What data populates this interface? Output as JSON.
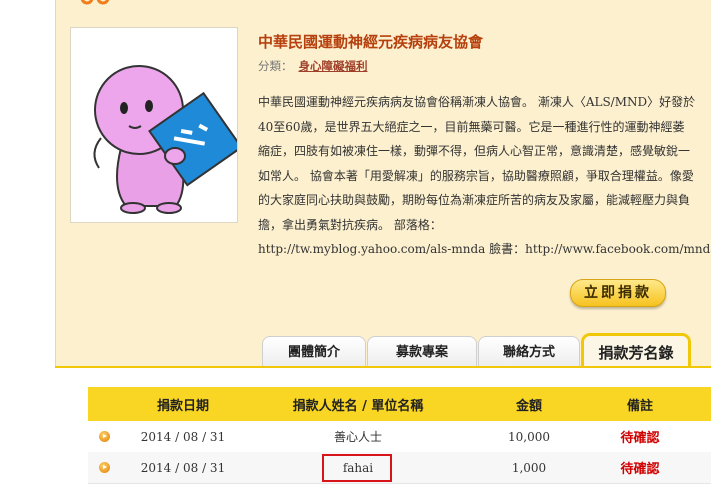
{
  "organization": {
    "name": "中華民國運動神經元疾病病友協會",
    "category_label": "分類：",
    "category_value": "身心障礙福利",
    "description": "中華民國運動神經元疾病病友協會俗稱漸凍人協會。 漸凍人〈ALS/MND〉好發於40至60歲，是世界五大絕症之一，目前無藥可醫。它是一種進行性的運動神經萎縮症，四肢有如被凍住一樣，動彈不得，但病人心智正常，意識清楚，感覺敏銳一如常人。 協會本著「用愛解凍」的服務宗旨，協助醫療照顧，爭取合理權益。像愛的大家庭同心扶助與鼓勵，期盼每位為漸凍症所苦的病友及家屬，能減輕壓力與負擔，拿出勇氣對抗疾病。 部落格：",
    "description_urls": "http://tw.myblog.yahoo.com/als-mnda 臉書：http://www.facebook.com/mnda.tw"
  },
  "donate_button_label": "立即捐款",
  "tabs": [
    {
      "label": "團體簡介"
    },
    {
      "label": "募款專案"
    },
    {
      "label": "聯絡方式"
    },
    {
      "label": "捐款芳名錄"
    }
  ],
  "table": {
    "headers": [
      "捐款日期",
      "捐款人姓名 / 單位名稱",
      "金額",
      "備註"
    ],
    "rows": [
      {
        "date": "2014 / 08 / 31",
        "name": "善心人士",
        "amount": "10,000",
        "status": "待確認"
      },
      {
        "date": "2014 / 08 / 31",
        "name": "fahai",
        "amount": "1,000",
        "status": "待確認"
      }
    ]
  },
  "colors": {
    "panel_bg": "#fdf0cf",
    "title": "#b7410e",
    "accent_yellow": "#f9d624",
    "status_red": "#d10000",
    "highlight": "#d7141a"
  },
  "icons": {
    "top_logo": "orange-bicycle-icon",
    "photo": "pink-character-holding-blue-card-illustration",
    "bullet": "orange-arrow-bullet-icon"
  }
}
